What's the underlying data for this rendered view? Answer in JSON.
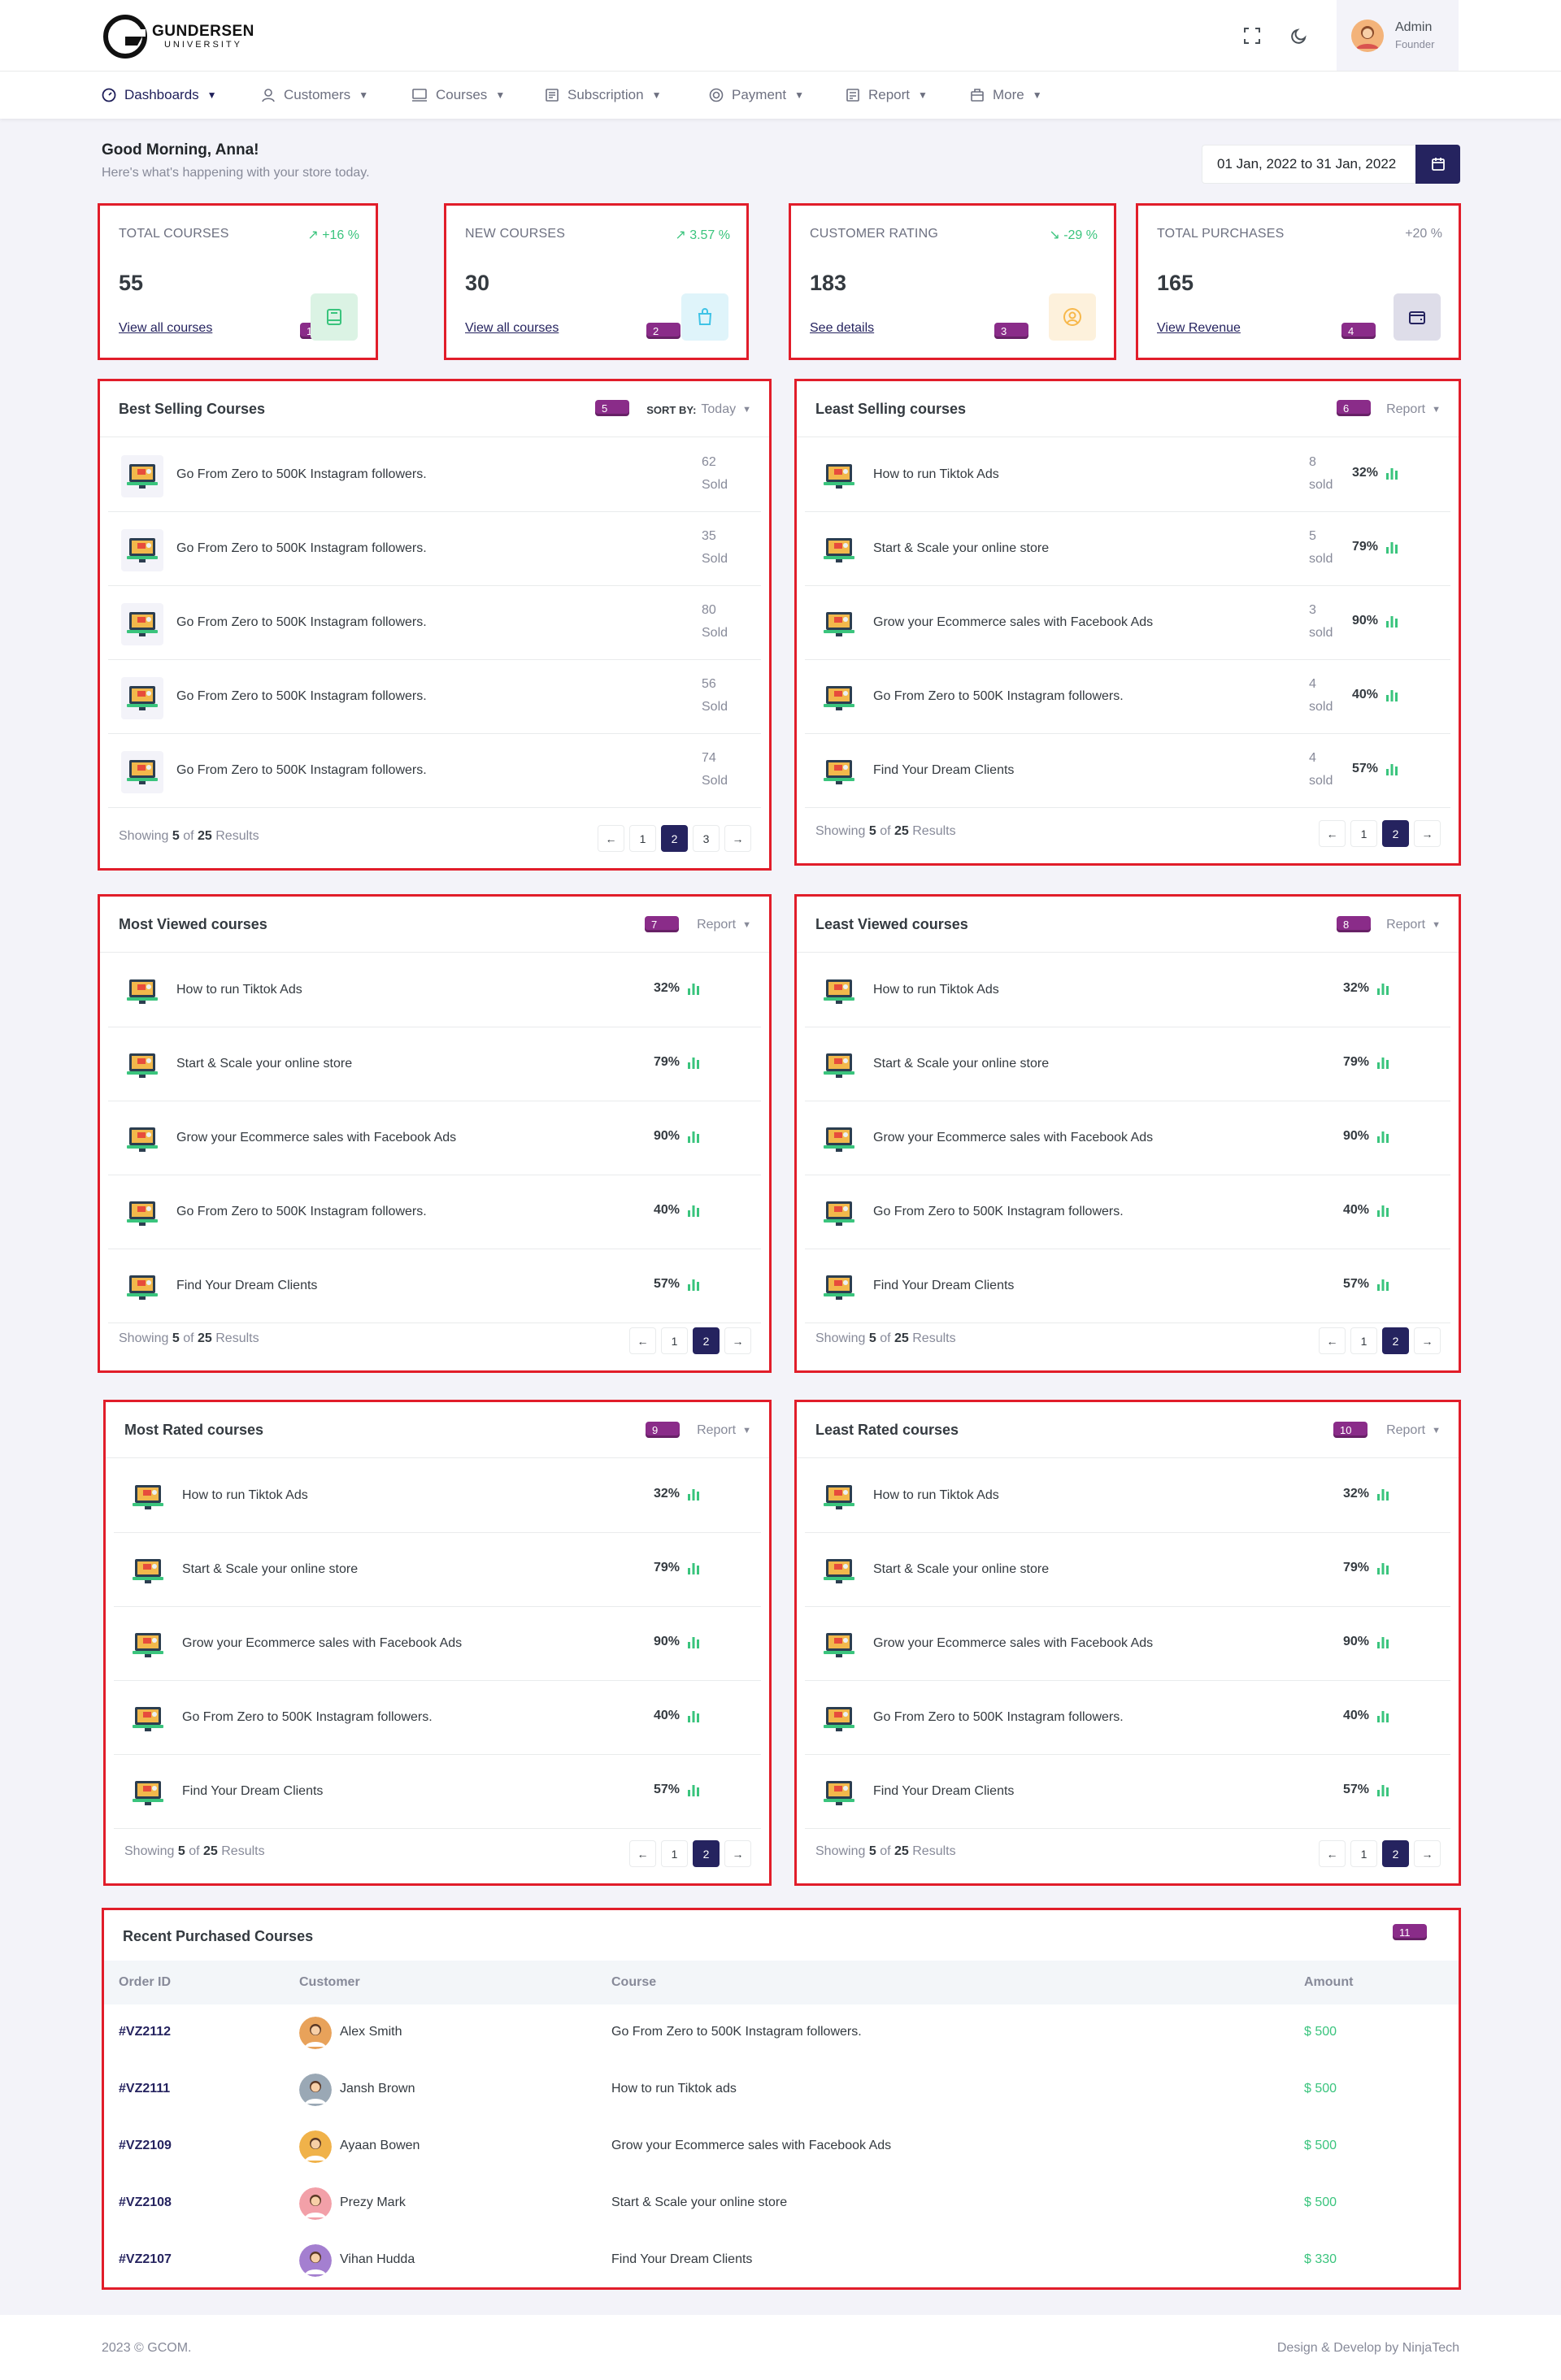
{
  "brand": {
    "name": "GUNDERSEN",
    "sub": "UNIVERSITY"
  },
  "user": {
    "name": "Admin",
    "role": "Founder"
  },
  "nav": [
    {
      "label": "Dashboards",
      "icon": "dashboard-icon",
      "active": true
    },
    {
      "label": "Customers",
      "icon": "user-icon"
    },
    {
      "label": "Courses",
      "icon": "monitor-icon"
    },
    {
      "label": "Subscription",
      "icon": "calendar-list-icon"
    },
    {
      "label": "Payment",
      "icon": "coin-icon"
    },
    {
      "label": "Report",
      "icon": "report-icon"
    },
    {
      "label": "More",
      "icon": "briefcase-icon"
    }
  ],
  "greeting": {
    "title": "Good Morning, Anna!",
    "subtitle": "Here's what's happening with your store today."
  },
  "date_range": "01 Jan, 2022 to 31 Jan, 2022",
  "stats": [
    {
      "label": "TOTAL COURSES",
      "change": "+16 %",
      "dir": "up",
      "value": "55",
      "link": "View all courses",
      "badge": "1",
      "icon": "book-icon",
      "icon_bg": "#dbf3e4",
      "icon_color": "#3ac47d"
    },
    {
      "label": "NEW COURSES",
      "change": "3.57 %",
      "dir": "up",
      "value": "30",
      "link": "View all courses",
      "badge": "2",
      "icon": "shopping-bag-icon",
      "icon_bg": "#dff4fa",
      "icon_color": "#3fc3e6"
    },
    {
      "label": "CUSTOMER RATING",
      "change": "-29 %",
      "dir": "down",
      "value": "183",
      "link": "See details",
      "badge": "3",
      "icon": "user-circle-icon",
      "icon_bg": "#fdf1dc",
      "icon_color": "#f7b84b"
    },
    {
      "label": "TOTAL PURCHASES",
      "change": "+20 %",
      "dir": "flat",
      "value": "165",
      "link": "View Revenue",
      "badge": "4",
      "icon": "wallet-icon",
      "icon_bg": "#dedde9",
      "icon_color": "#25235f"
    }
  ],
  "best_selling": {
    "title": "Best Selling Courses",
    "badge": "5",
    "sort_label": "SORT BY:",
    "sort_value": "Today",
    "rows": [
      {
        "name": "Go From Zero to 500K Instagram followers.",
        "count": "62",
        "unit": "Sold"
      },
      {
        "name": "Go From Zero to 500K Instagram followers.",
        "count": "35",
        "unit": "Sold"
      },
      {
        "name": "Go From Zero to 500K Instagram followers.",
        "count": "80",
        "unit": "Sold"
      },
      {
        "name": "Go From Zero to 500K Instagram followers.",
        "count": "56",
        "unit": "Sold"
      },
      {
        "name": "Go From Zero to 500K Instagram followers.",
        "count": "74",
        "unit": "Sold"
      }
    ],
    "footer": {
      "prefix": "Showing",
      "shown": "5",
      "of": "of",
      "total": "25",
      "suffix": "Results"
    },
    "pages": [
      "1",
      "2",
      "3"
    ],
    "active_page": "2"
  },
  "least_selling": {
    "title": "Least Selling courses",
    "badge": "6",
    "control": "Report",
    "rows": [
      {
        "name": "How to run Tiktok Ads",
        "count": "8",
        "unit": "sold",
        "pct": "32%"
      },
      {
        "name": "Start & Scale your online store",
        "count": "5",
        "unit": "sold",
        "pct": "79%"
      },
      {
        "name": "Grow your Ecommerce sales with Facebook Ads",
        "count": "3",
        "unit": "sold",
        "pct": "90%"
      },
      {
        "name": "Go From Zero to 500K Instagram followers.",
        "count": "4",
        "unit": "sold",
        "pct": "40%"
      },
      {
        "name": "Find Your Dream Clients",
        "count": "4",
        "unit": "sold",
        "pct": "57%"
      }
    ],
    "footer": {
      "prefix": "Showing",
      "shown": "5",
      "of": "of",
      "total": "25",
      "suffix": "Results"
    },
    "pages": [
      "1",
      "2"
    ],
    "active_page": "2"
  },
  "pct_panels": [
    {
      "title": "Most Viewed courses",
      "badge": "7",
      "control": "Report"
    },
    {
      "title": "Least Viewed courses",
      "badge": "8",
      "control": "Report"
    },
    {
      "title": "Most Rated courses",
      "badge": "9",
      "control": "Report"
    },
    {
      "title": "Least Rated courses",
      "badge": "10",
      "control": "Report"
    }
  ],
  "pct_rows": [
    {
      "name": "How to run Tiktok Ads",
      "pct": "32%"
    },
    {
      "name": "Start & Scale your online store",
      "pct": "79%"
    },
    {
      "name": "Grow your Ecommerce sales with Facebook Ads",
      "pct": "90%"
    },
    {
      "name": "Go From Zero to 500K Instagram followers.",
      "pct": "40%"
    },
    {
      "name": "Find Your Dream Clients",
      "pct": "57%"
    }
  ],
  "pct_footer": {
    "prefix": "Showing",
    "shown": "5",
    "of": "of",
    "total": "25",
    "suffix": "Results"
  },
  "pct_pages": [
    "1",
    "2"
  ],
  "pct_active_page": "2",
  "recent": {
    "title": "Recent Purchased Courses",
    "badge": "11",
    "columns": [
      "Order ID",
      "Customer",
      "Course",
      "Amount"
    ],
    "rows": [
      {
        "order_id": "#VZ2112",
        "customer": "Alex Smith",
        "course": "Go From Zero to 500K Instagram followers.",
        "amount": "$ 500",
        "avatar_color": "#e8a25a"
      },
      {
        "order_id": "#VZ2111",
        "customer": "Jansh Brown",
        "course": "How to run Tiktok ads",
        "amount": "$ 500",
        "avatar_color": "#9aa8b5"
      },
      {
        "order_id": "#VZ2109",
        "customer": "Ayaan Bowen",
        "course": "Grow your Ecommerce sales with Facebook Ads",
        "amount": "$ 500",
        "avatar_color": "#f0b24a"
      },
      {
        "order_id": "#VZ2108",
        "customer": "Prezy Mark",
        "course": "Start & Scale your online store",
        "amount": "$ 500",
        "avatar_color": "#f2a0a8"
      },
      {
        "order_id": "#VZ2107",
        "customer": "Vihan Hudda",
        "course": "Find Your Dream Clients",
        "amount": "$ 330",
        "avatar_color": "#a47fd0"
      }
    ]
  },
  "footer": {
    "left": "2023 © GCOM.",
    "right": "Design & Develop by NinjaTech"
  },
  "colors": {
    "primary": "#25235f",
    "success": "#3ac47d",
    "danger_border": "#e11d2a",
    "badge": "#8a2c89"
  }
}
